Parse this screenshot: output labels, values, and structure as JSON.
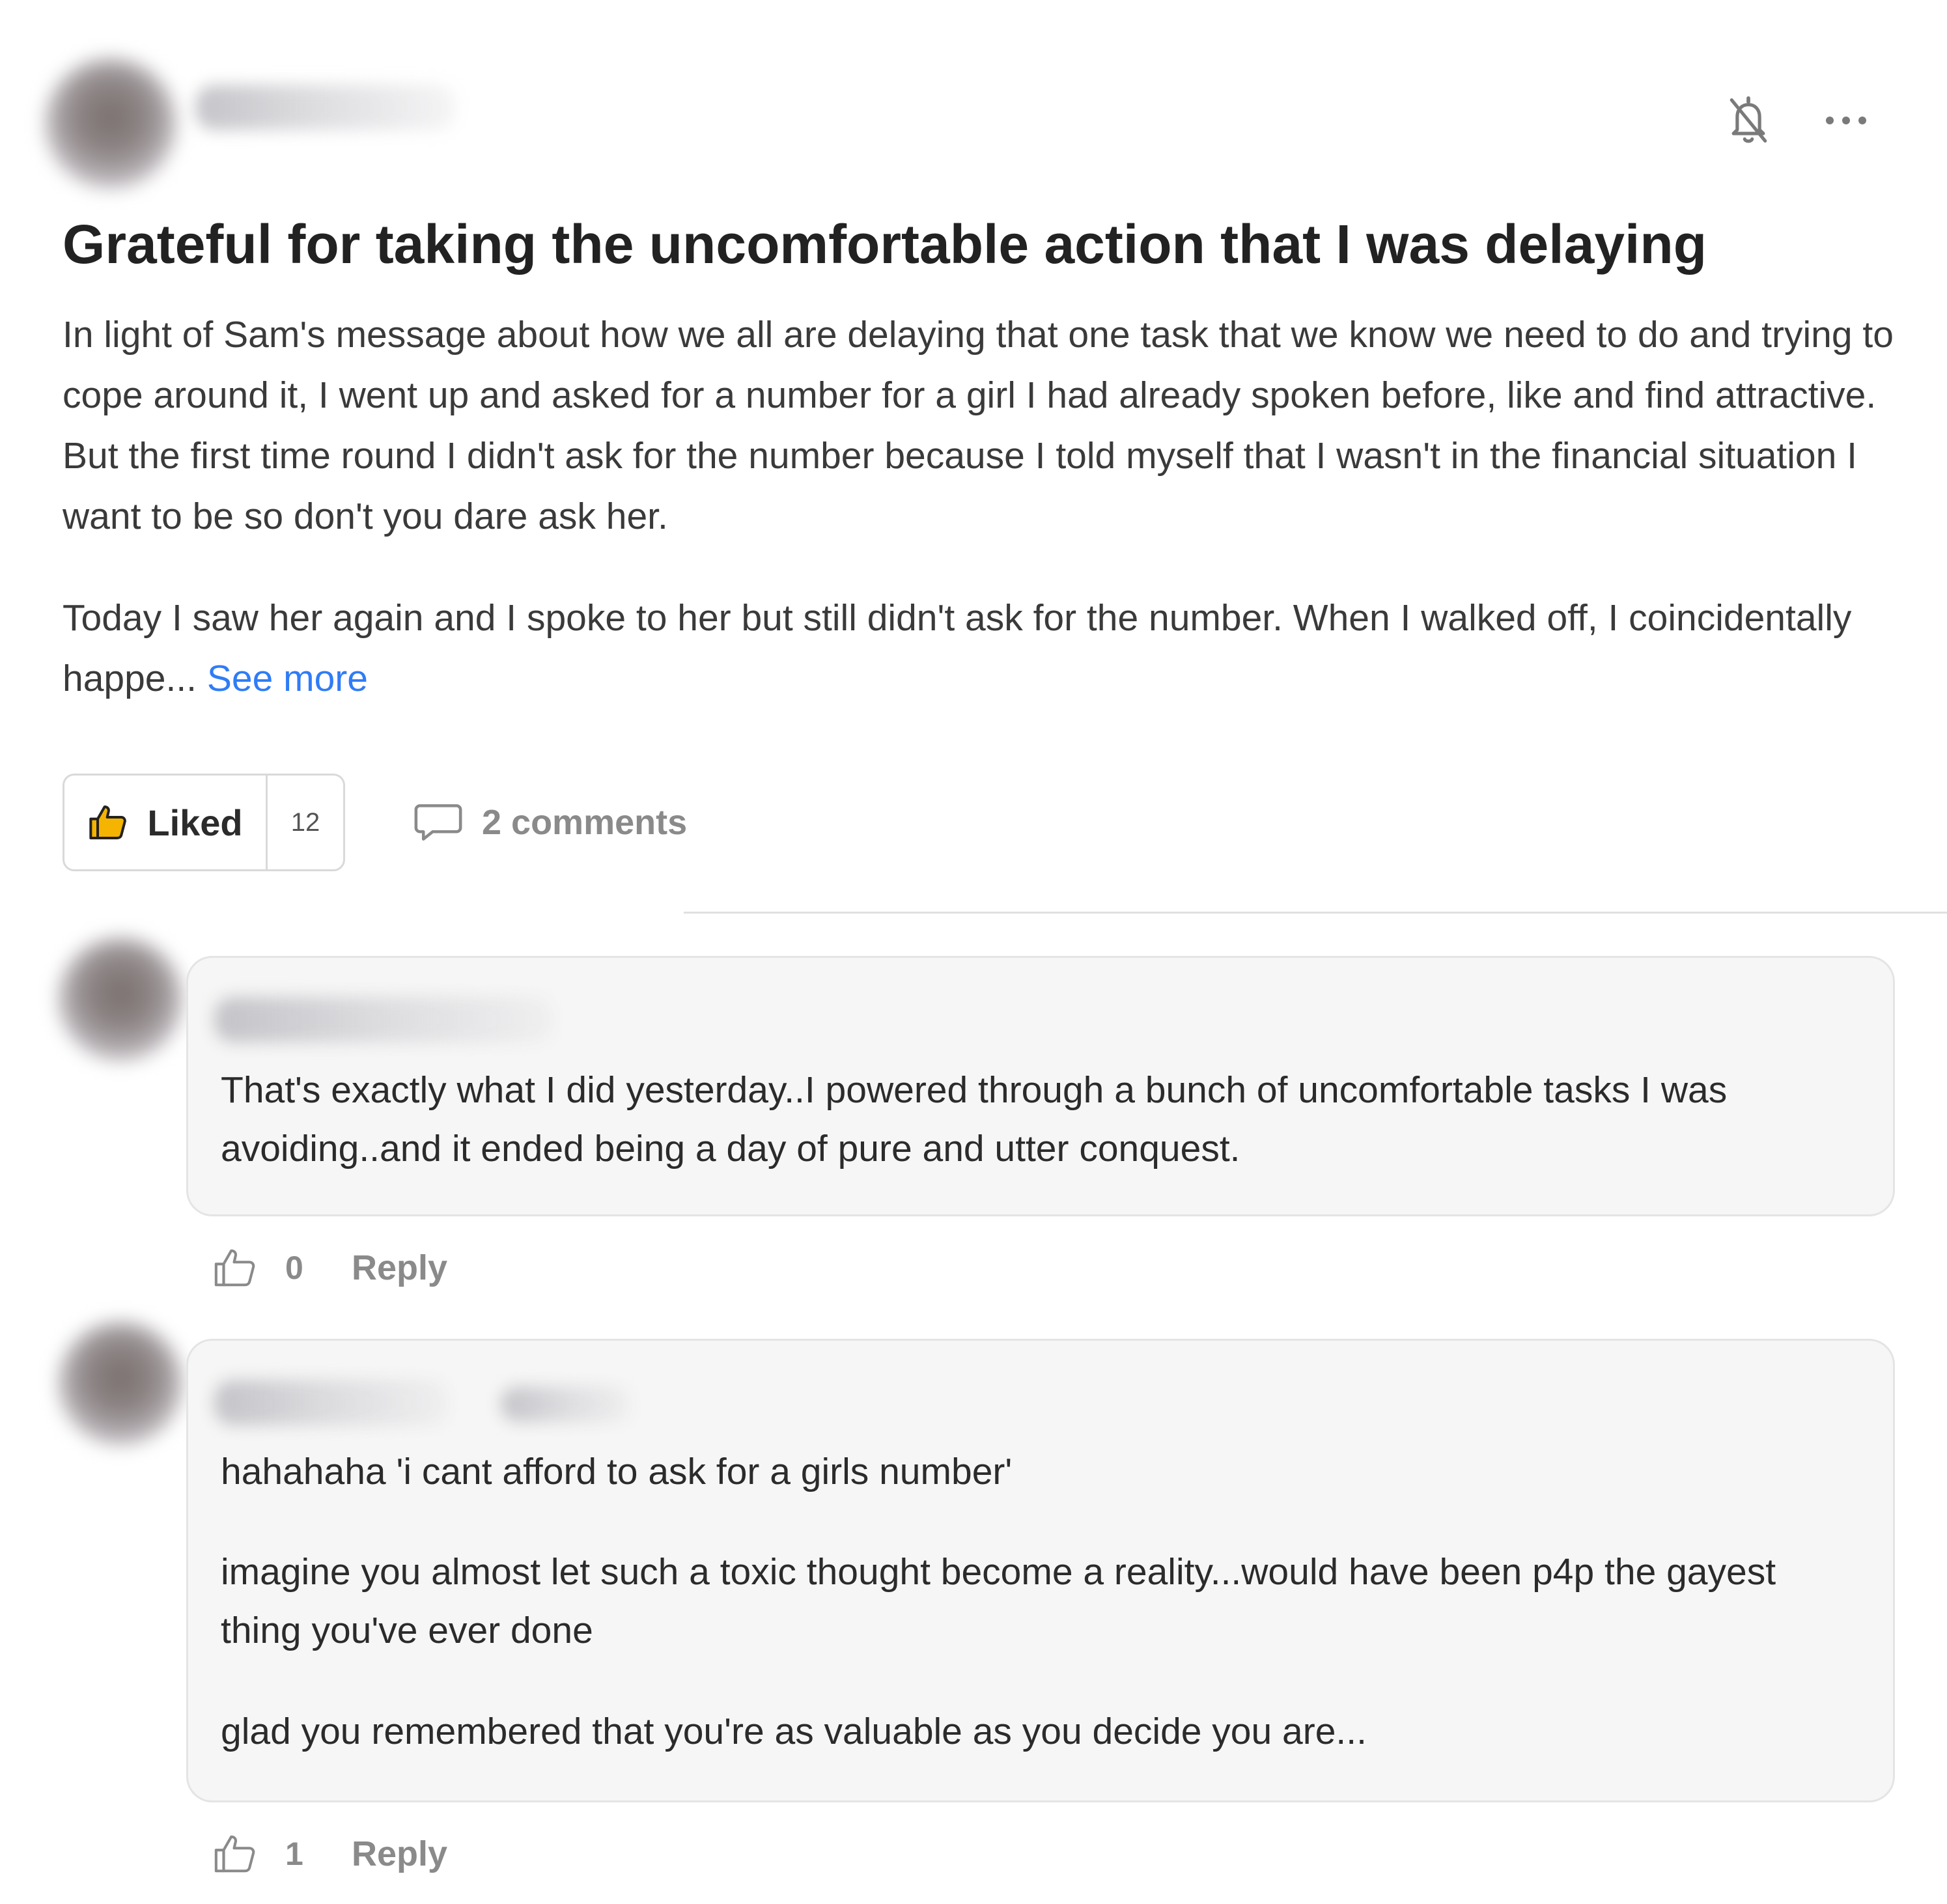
{
  "post": {
    "title": "Grateful for taking the uncomfortable action that I was delaying",
    "body_p1": "In light of Sam's message about how we all are delaying that one task that we know we need to do and trying to cope around it, I went up and asked for a number for a girl I had already spoken before, like and find attractive. But the first time round I didn't ask for the number because I told myself that I wasn't in the financial situation I want to be so don't you dare ask her.",
    "body_p2": "Today I saw her again and I spoke to her but still didn't ask for the number. When I walked off, I coincidentally happe...",
    "see_more_label": "See more",
    "liked_label": "Liked",
    "like_count": "12",
    "comments_label": "2 comments",
    "icons": {
      "bell": "bell-off-icon",
      "more": "more-horizontal-icon",
      "like": "thumbs-up-icon",
      "comment": "comment-bubble-icon"
    }
  },
  "comments": [
    {
      "text": "That's exactly what I did yesterday..I powered through a bunch of uncomfortable tasks I was avoiding..and it ended being a day of pure and utter conquest.",
      "like_count": "0",
      "reply_label": "Reply"
    },
    {
      "paragraphs": [
        "hahahaha 'i cant afford to ask for a girls number'",
        "imagine you almost let such a toxic thought become a reality...would have been p4p the gayest thing you've ever done",
        "glad you remembered that you're as valuable as you decide you are..."
      ],
      "like_count": "1",
      "reply_label": "Reply"
    }
  ],
  "colors": {
    "link": "#2f7cf6",
    "muted": "#8a8a8a",
    "bubble_bg": "#f6f6f6",
    "border": "#d9d9d9"
  }
}
